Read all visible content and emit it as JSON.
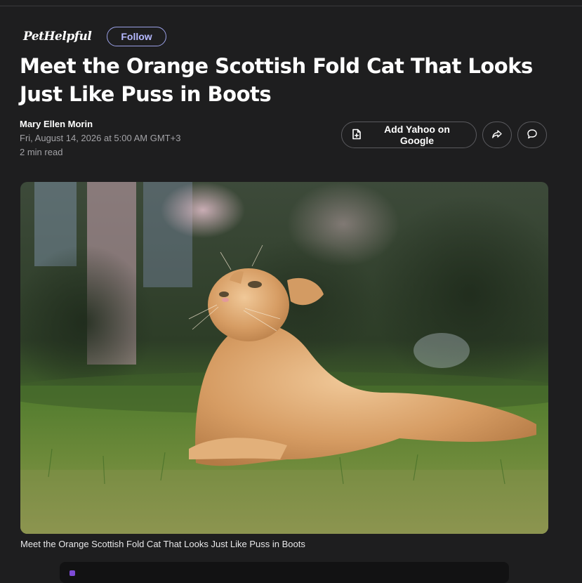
{
  "header": {
    "brand_logo": "PetHelpful",
    "follow_label": "Follow"
  },
  "article": {
    "title": "Meet the Orange Scottish Fold Cat That Looks Just Like Puss in Boots",
    "author": "Mary Ellen Morin",
    "date": "Fri, August 14, 2026 at 5:00 AM GMT+3",
    "read_time": "2 min read",
    "image_caption": "Meet the Orange Scottish Fold Cat That Looks Just Like Puss in Boots"
  },
  "actions": {
    "add_yahoo_label": "Add Yahoo on Google",
    "add_icon": "document-plus-icon",
    "share_icon": "share-arrow-icon",
    "comment_icon": "comment-bubble-icon"
  },
  "colors": {
    "background": "#1e1e1f",
    "follow_accent": "#b6b9ff",
    "text_secondary": "#a2a2a6",
    "button_border": "#5a5a5e"
  }
}
